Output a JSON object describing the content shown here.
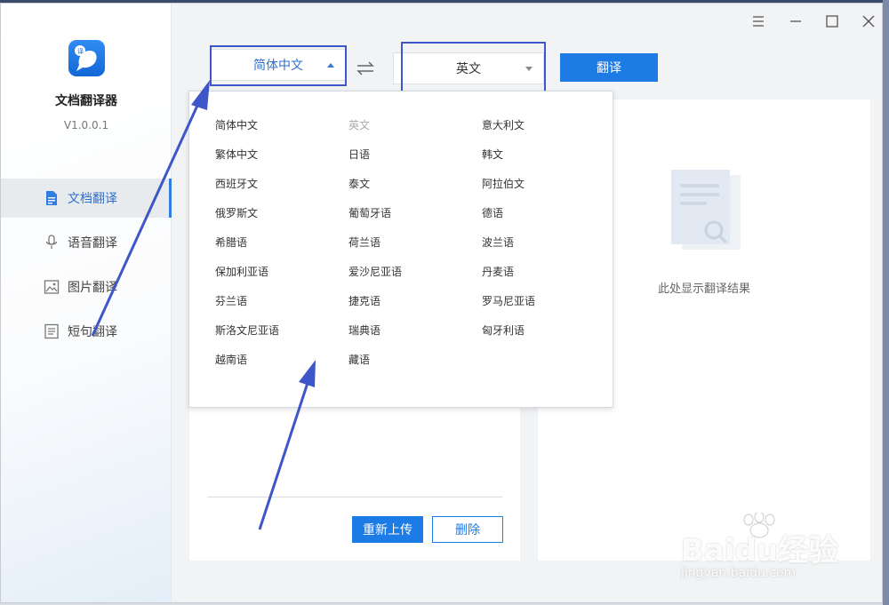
{
  "app": {
    "title": "文档翻译器",
    "version": "V1.0.0.1"
  },
  "sidebar": {
    "items": [
      {
        "label": "文档翻译",
        "icon": "document-icon",
        "active": true
      },
      {
        "label": "语音翻译",
        "icon": "microphone-icon",
        "active": false
      },
      {
        "label": "图片翻译",
        "icon": "image-icon",
        "active": false
      },
      {
        "label": "短句翻译",
        "icon": "text-lines-icon",
        "active": false
      }
    ]
  },
  "window_controls": [
    "menu-icon",
    "minimize-icon",
    "maximize-icon",
    "close-icon"
  ],
  "toolbar": {
    "source_lang": "简体中文",
    "target_lang": "英文",
    "translate_label": "翻译"
  },
  "dropdown": {
    "columns": [
      [
        "简体中文",
        "繁体中文",
        "西班牙文",
        "俄罗斯文",
        "希腊语",
        "保加利亚语",
        "芬兰语",
        "斯洛文尼亚语",
        "越南语"
      ],
      [
        "英文",
        "日语",
        "泰文",
        "葡萄牙语",
        "荷兰语",
        "爱沙尼亚语",
        "捷克语",
        "瑞典语",
        "藏语"
      ],
      [
        "意大利文",
        "韩文",
        "阿拉伯文",
        "德语",
        "波兰语",
        "丹麦语",
        "罗马尼亚语",
        "匈牙利语"
      ]
    ],
    "disabled_option": "英文"
  },
  "left_panel": {
    "reupload_label": "重新上传",
    "delete_label": "删除"
  },
  "right_panel": {
    "hint": "此处显示翻译结果"
  },
  "watermark": {
    "brand": "Baidu经验",
    "url": "jingyan.baidu.com"
  },
  "colors": {
    "accent": "#1d7be6",
    "highlight_box": "#3f56c9"
  }
}
